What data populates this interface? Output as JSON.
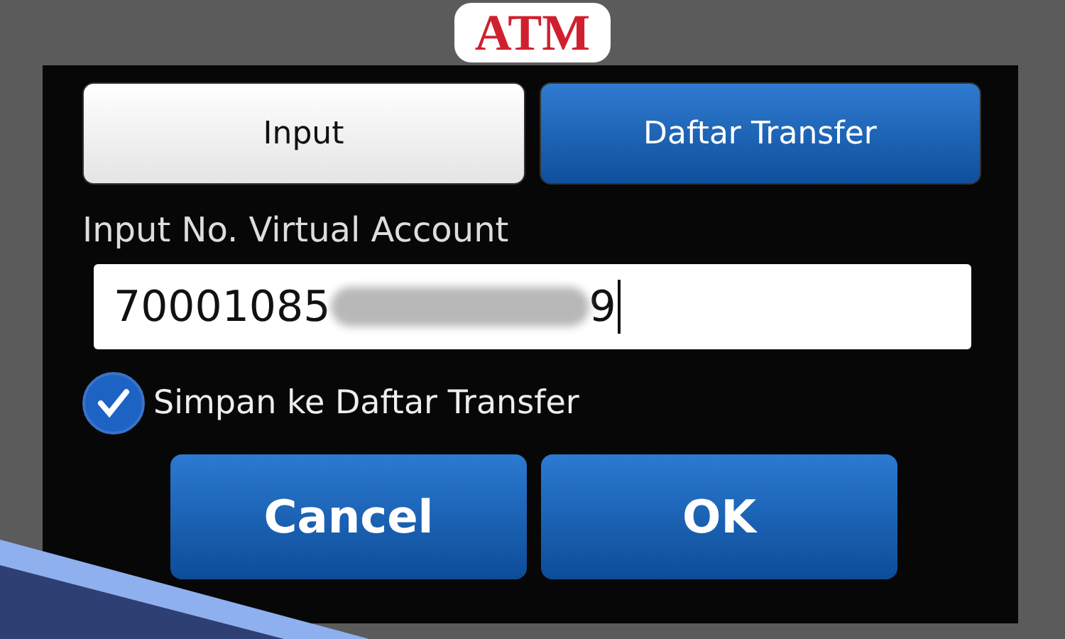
{
  "banner": {
    "text": "ATM"
  },
  "tabs": [
    {
      "label": "Input",
      "selected": false
    },
    {
      "label": "Daftar Transfer",
      "selected": true
    }
  ],
  "field": {
    "label": "Input No. Virtual Account",
    "value_start": "70001085",
    "value_end": "9",
    "masked": true
  },
  "save_option": {
    "label": "Simpan ke Daftar Transfer",
    "checked": true
  },
  "buttons": [
    "Cancel",
    "OK"
  ]
}
